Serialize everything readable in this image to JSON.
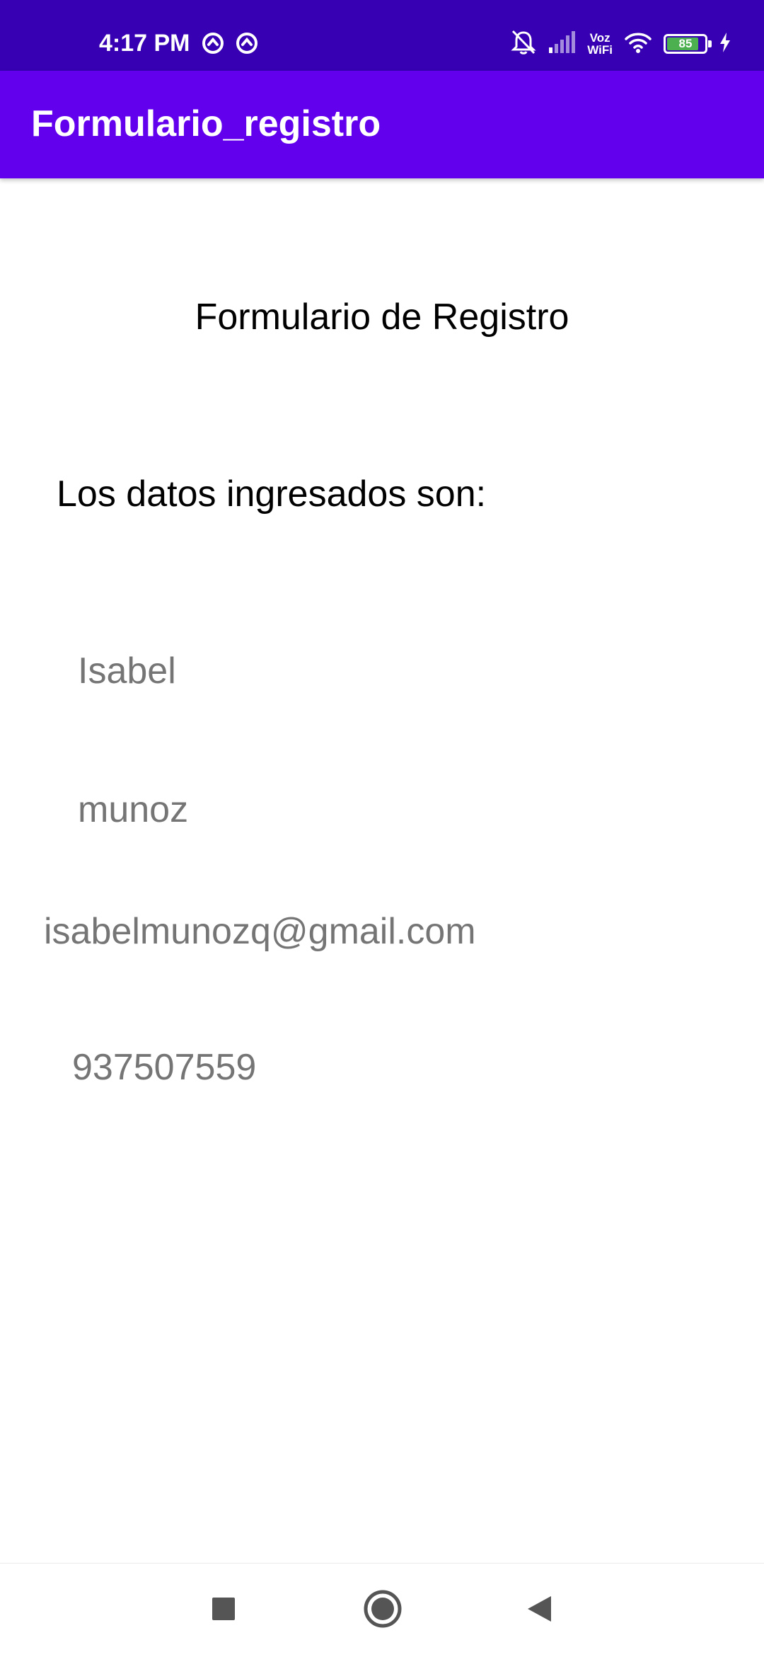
{
  "status_bar": {
    "time": "4:17 PM",
    "left_icons": [
      "notification-icon",
      "notification-icon"
    ],
    "volte": [
      "Voz",
      "WiFi"
    ],
    "battery_level": "85",
    "battery_percent": 85,
    "background": "#3700b3"
  },
  "app_bar": {
    "title": "Formulario_registro",
    "background": "#6200ee"
  },
  "content": {
    "form_title": "Formulario de Registro",
    "heading": "Los datos ingresados son:",
    "fields": {
      "first_name": "Isabel",
      "last_name": "munoz",
      "email": "isabelmunozq@gmail.com",
      "phone": "937507559"
    },
    "value_color": "#757575"
  },
  "navigation_bar": {
    "buttons": [
      "recents-icon",
      "home-icon",
      "back-icon"
    ]
  }
}
